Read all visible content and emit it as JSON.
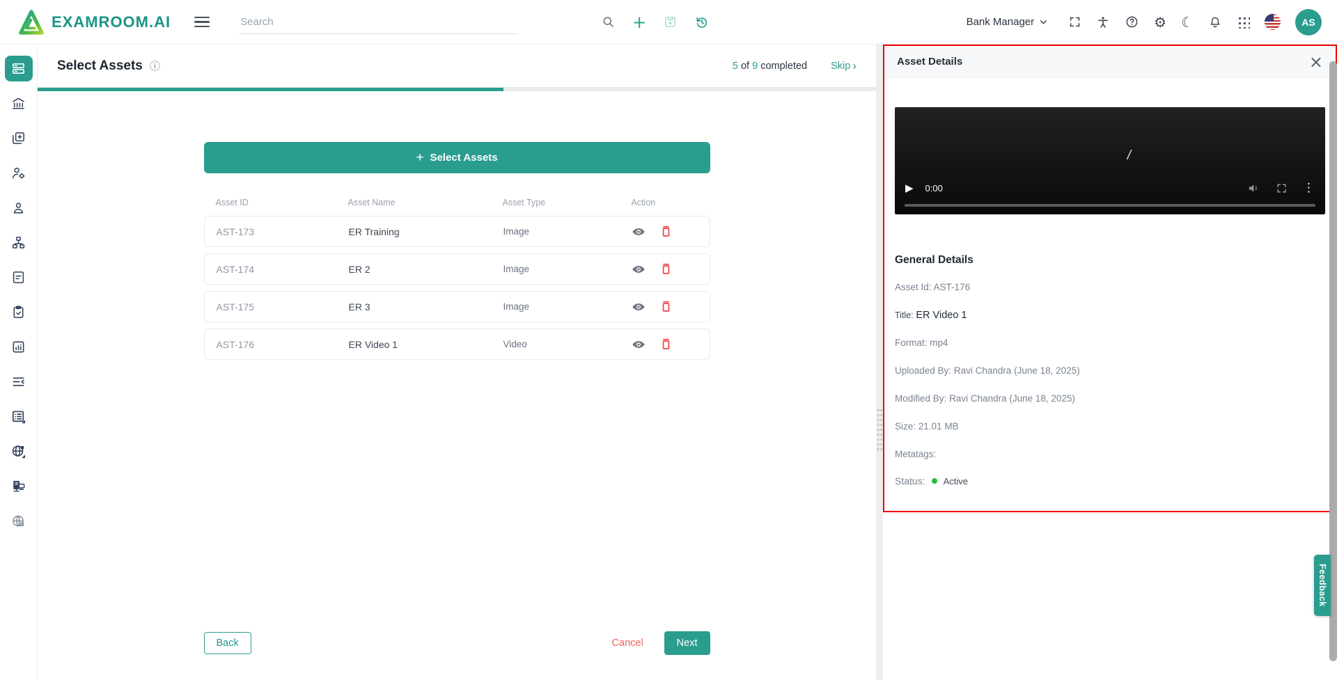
{
  "navbar": {
    "brand": "EXAMROOM.AI",
    "search_placeholder": "Search",
    "role_selector": "Bank Manager",
    "avatar_initials": "AS",
    "icon_names": [
      "search-icon",
      "plus-icon",
      "save-icon",
      "history-icon",
      "fullscreen-icon",
      "accessibility-icon",
      "help-icon",
      "settings-gear-icon",
      "dark-mode-moon-icon",
      "notifications-bell-icon",
      "apps-grid-icon",
      "language-flag-us-icon"
    ]
  },
  "sidebar": {
    "icon_names": [
      "content-rows",
      "bank-institution",
      "copy-add",
      "user-settings",
      "user",
      "hierarchy",
      "document",
      "clipboard-check",
      "chart-report",
      "list-collapse",
      "list-export",
      "globe-export",
      "server-network",
      "globe-settings"
    ],
    "active_index": 0
  },
  "header": {
    "title": "Select Assets",
    "progress_current": "5",
    "progress_of": " of ",
    "progress_total": "9",
    "progress_suffix": " completed",
    "skip_label": "Skip",
    "progress_percent": "55.6"
  },
  "main": {
    "select_assets_button": "Select Assets",
    "table": {
      "columns": [
        "Asset ID",
        "Asset Name",
        "Asset Type",
        "Action"
      ],
      "rows": [
        {
          "id": "AST-173",
          "name": "ER Training",
          "type": "Image"
        },
        {
          "id": "AST-174",
          "name": "ER 2",
          "type": "Image"
        },
        {
          "id": "AST-175",
          "name": "ER 3",
          "type": "Image"
        },
        {
          "id": "AST-176",
          "name": "ER Video 1",
          "type": "Video"
        }
      ]
    },
    "back_button": "Back",
    "cancel_button": "Cancel",
    "next_button": "Next"
  },
  "panel": {
    "title": "Asset Details",
    "video": {
      "time": "0:00",
      "frame_glyph": "/"
    },
    "section_title": "General Details",
    "details": [
      {
        "label": "Asset Id:",
        "value": "AST-176"
      },
      {
        "label": "Title:",
        "value": "ER Video 1"
      },
      {
        "label": "Format:",
        "value": "mp4"
      },
      {
        "label": "Uploaded By:",
        "value": "Ravi Chandra (June 18, 2025)"
      },
      {
        "label": "Modified By:",
        "value": "Ravi Chandra (June 18, 2025)"
      },
      {
        "label": "Size:",
        "value": "21.01 MB"
      },
      {
        "label": "Metatags:",
        "value": ""
      }
    ],
    "status_label": "Status:",
    "status_value": "Active"
  },
  "feedback_tab": "Feedback",
  "icons": {
    "plus": "+",
    "gear": "⚙",
    "moon": "☾",
    "kebab": "⋮",
    "play": "▶",
    "close": "×",
    "skip_chevron": "›",
    "info": "ⓘ"
  },
  "colors": {
    "accent_teal": "#2a9d8f",
    "panel_border_red": "#f00100",
    "cancel_red": "#f2635a",
    "trash_red": "#ee4545",
    "status_green": "#2db83d"
  }
}
